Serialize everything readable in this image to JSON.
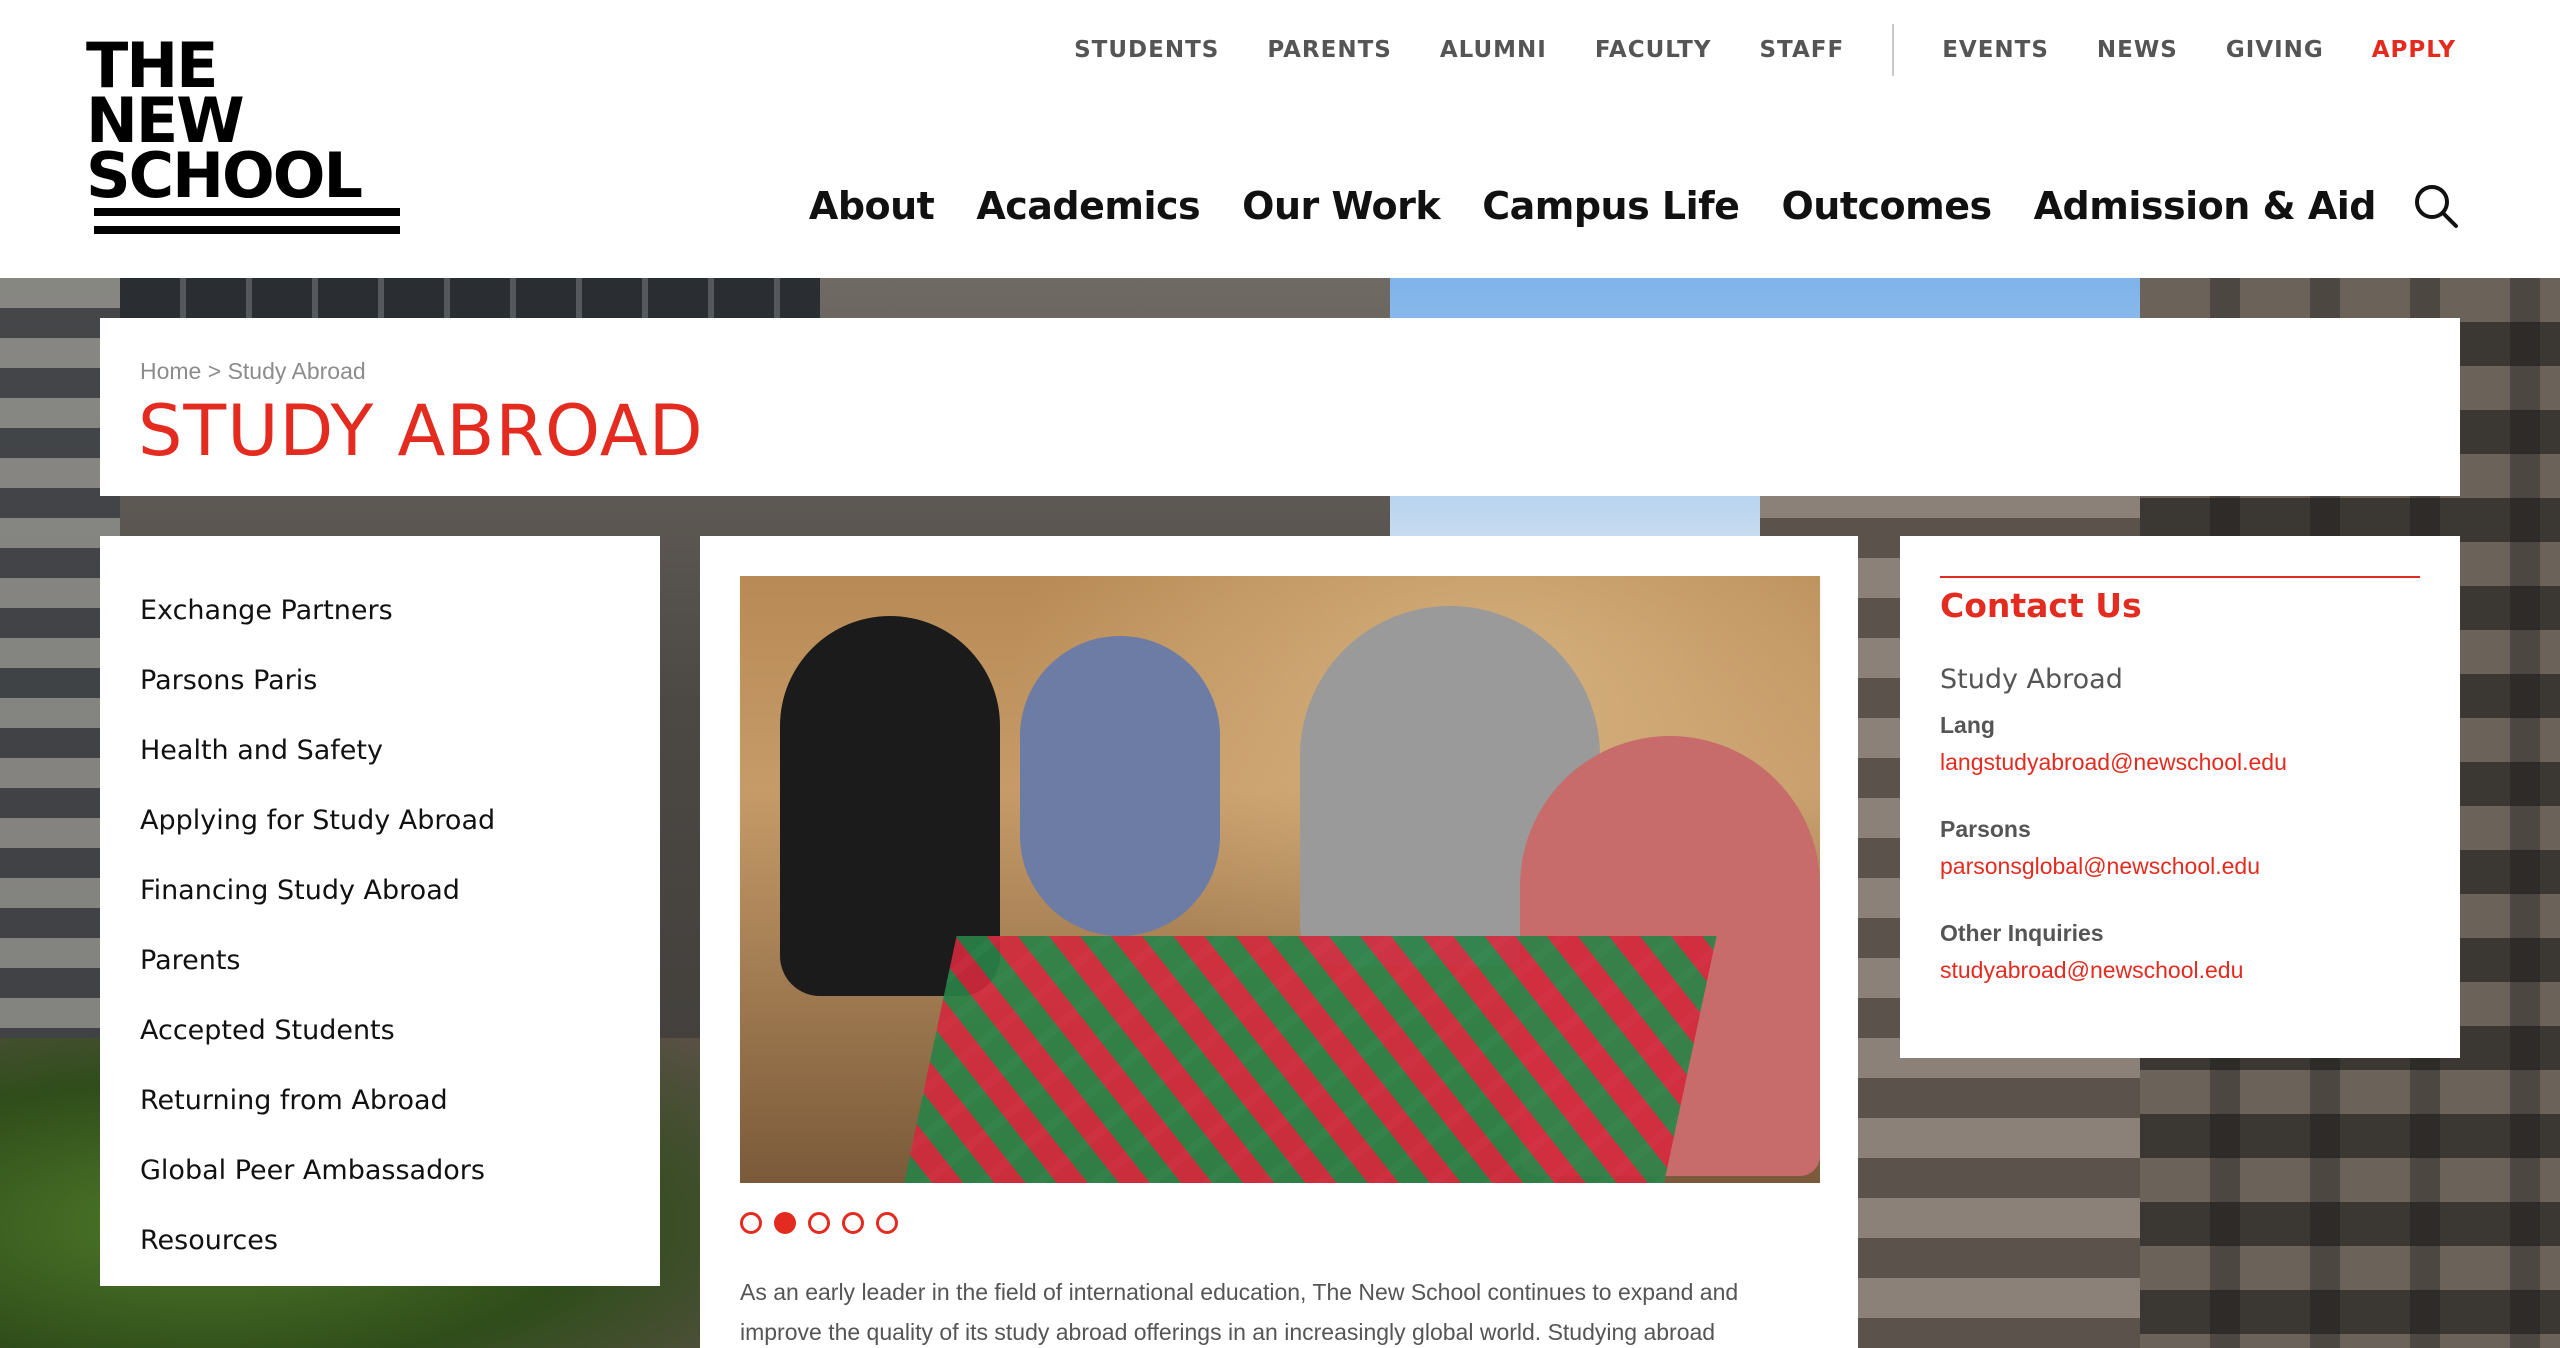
{
  "logo": {
    "lines": [
      "THE",
      "NEW",
      "SCHOOL"
    ]
  },
  "utility_nav": {
    "audience": [
      "STUDENTS",
      "PARENTS",
      "ALUMNI",
      "FACULTY",
      "STAFF"
    ],
    "other": [
      "EVENTS",
      "NEWS",
      "GIVING",
      "APPLY"
    ]
  },
  "main_nav": [
    "About",
    "Academics",
    "Our Work",
    "Campus Life",
    "Outcomes",
    "Admission & Aid"
  ],
  "breadcrumb": {
    "home": "Home",
    "separator": ">",
    "current": "Study Abroad"
  },
  "page_title": "STUDY ABROAD",
  "side_nav": [
    "Exchange Partners",
    "Parsons Paris",
    "Health and Safety",
    "Applying for Study Abroad",
    "Financing Study Abroad",
    "Parents",
    "Accepted Students",
    "Returning from Abroad",
    "Global Peer Ambassadors",
    "Resources"
  ],
  "slideshow": {
    "count": 5,
    "active_index": 1
  },
  "intro": {
    "line1": "As an early leader in the field of international education, The New School continues to expand and",
    "line2": "improve the quality of its study abroad offerings in an increasingly global world. Studying abroad"
  },
  "contact": {
    "heading": "Contact Us",
    "department": "Study Abroad",
    "entries": [
      {
        "label": "Lang",
        "email": "langstudyabroad@newschool.edu"
      },
      {
        "label": "Parsons",
        "email": "parsonsglobal@newschool.edu"
      },
      {
        "label": "Other Inquiries",
        "email": "studyabroad@newschool.edu"
      }
    ]
  },
  "colors": {
    "accent": "#e32b1f",
    "text": "#111111",
    "muted": "#555555"
  },
  "icons": {
    "search": "search-icon"
  }
}
